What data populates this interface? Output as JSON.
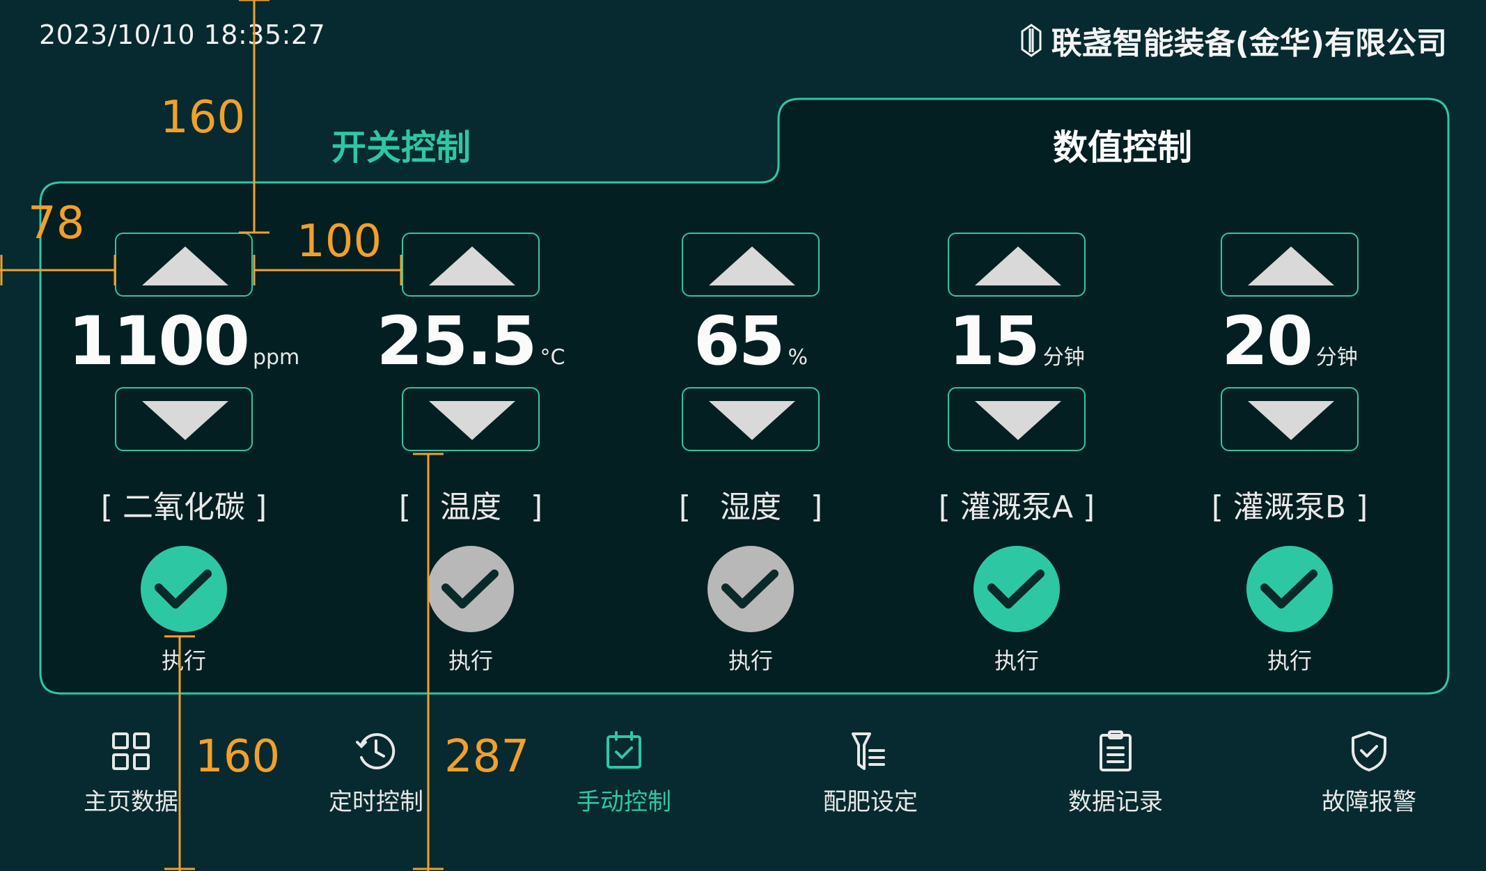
{
  "header": {
    "datetime": "2023/10/10 18:35:27",
    "company": "联盏智能装备(金华)有限公司"
  },
  "tabs": [
    {
      "label": "开关控制",
      "active": false
    },
    {
      "label": "数值控制",
      "active": true
    }
  ],
  "controls": [
    {
      "value": "1100",
      "unit": "ppm",
      "label": "[ 二氧化碳 ]",
      "exec_label": "执行",
      "exec_active": true
    },
    {
      "value": "25.5",
      "unit": "°C",
      "label": "[   温度   ]",
      "exec_label": "执行",
      "exec_active": false
    },
    {
      "value": "65",
      "unit": "%",
      "label": "[   湿度   ]",
      "exec_label": "执行",
      "exec_active": false
    },
    {
      "value": "15",
      "unit": "分钟",
      "label": "[ 灌溉泵A ]",
      "exec_label": "执行",
      "exec_active": true
    },
    {
      "value": "20",
      "unit": "分钟",
      "label": "[ 灌溉泵B ]",
      "exec_label": "执行",
      "exec_active": true
    }
  ],
  "nav": [
    {
      "label": "主页数据",
      "icon": "grid-icon",
      "active": false
    },
    {
      "label": "定时控制",
      "icon": "clock-icon",
      "active": false
    },
    {
      "label": "手动控制",
      "icon": "calendar-check-icon",
      "active": true
    },
    {
      "label": "配肥设定",
      "icon": "funnel-list-icon",
      "active": false
    },
    {
      "label": "数据记录",
      "icon": "clipboard-icon",
      "active": false
    },
    {
      "label": "故障报警",
      "icon": "shield-check-icon",
      "active": false
    }
  ],
  "annotations": {
    "labels": [
      "160",
      "78",
      "100",
      "160",
      "287"
    ]
  },
  "colors": {
    "background": "#062a2f",
    "panel": "#041f22",
    "accent": "#2ec7a4",
    "inactive": "#b8b8b8",
    "annotation": "#f2a02b"
  }
}
